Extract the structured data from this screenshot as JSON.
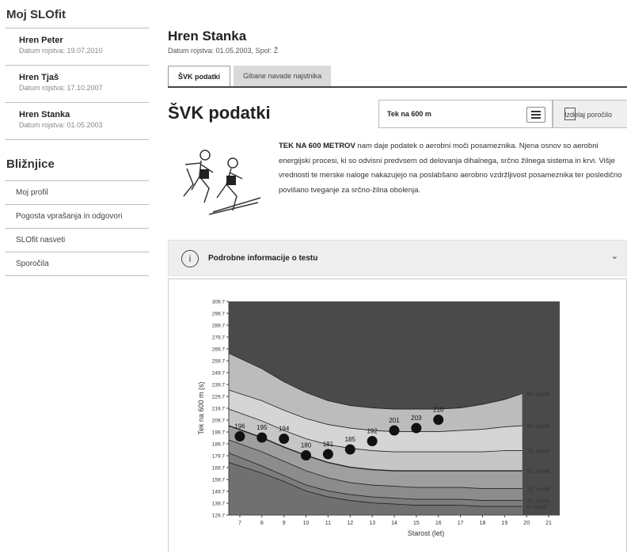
{
  "sidebar": {
    "title": "Moj SLOfit",
    "athletes": [
      {
        "name": "Hren Peter",
        "dob": "Datum rojstva: 19.07.2010"
      },
      {
        "name": "Hren Tjaš",
        "dob": "Datum rojstva: 17.10.2007"
      },
      {
        "name": "Hren Stanka",
        "dob": "Datum rojstva: 01.05.2003"
      }
    ],
    "shortcuts_title": "Bližnjice",
    "shortcuts": [
      "Moj profil",
      "Pogosta vprašanja in odgovori",
      "SLOfit nasveti",
      "Sporočila"
    ]
  },
  "main": {
    "athlete_name": "Hren Stanka",
    "athlete_meta": "Datum rojstva: 01.05.2003, Spol: Ž",
    "tabs": [
      {
        "label": "ŠVK podatki",
        "active": true
      },
      {
        "label": "Gibane navade najstnika",
        "active": false
      }
    ],
    "section_title": "ŠVK podatki",
    "test_select": "Tek na 600 m",
    "report_button": "Izdelaj poročilo",
    "description_bold": "TEK NA 600 METROV",
    "description_rest": " nam daje podatek o aerobni moči posameznika. Njena osnov so aerobni energijski procesi, ki so odvisni predvsem od delovanja dihalnega, srčno žilnega sistema in krvi. Višje vrednosti te merske naloge nakazujejo na poslabšano aerobno vzdržljivost posameznika ter posledično povišano tveganje za srčno-žilna obolenja.",
    "info_icon": "i",
    "info_title": "Podrobne informacije o testu",
    "info_chevron": "⌄"
  },
  "chart_data": {
    "type": "area",
    "xlabel": "Starost (let)",
    "ylabel": "Tek na 600 m (s)",
    "xlim": [
      6.5,
      21.5
    ],
    "ylim": [
      129.7,
      309.7
    ],
    "x_ticks": [
      "7",
      "8",
      "9",
      "10",
      "11",
      "12",
      "13",
      "14",
      "15",
      "16",
      "17",
      "18",
      "19",
      "20",
      "21"
    ],
    "y_ticks": [
      "129.7",
      "139.7",
      "149.7",
      "159.7",
      "169.7",
      "179.7",
      "189.7",
      "199.7",
      "209.7",
      "219.7",
      "229.7",
      "239.7",
      "249.7",
      "259.7",
      "269.7",
      "279.7",
      "289.7",
      "299.7",
      "309.7"
    ],
    "percentiles": [
      {
        "name": "5. centil",
        "x": [
          6.5,
          8,
          9,
          10,
          11,
          12,
          13,
          14,
          15,
          16,
          17,
          18,
          19,
          19.8
        ],
        "y": [
          174,
          165,
          158,
          150,
          145,
          142,
          140,
          139,
          138,
          138,
          138,
          137,
          137,
          137
        ]
      },
      {
        "name": "10. centil",
        "x": [
          6.5,
          8,
          9,
          10,
          11,
          12,
          13,
          14,
          15,
          16,
          17,
          18,
          19,
          19.8
        ],
        "y": [
          182,
          171,
          163,
          155,
          150,
          147,
          145,
          144,
          143,
          143,
          143,
          142,
          142,
          142
        ]
      },
      {
        "name": "25. centil",
        "x": [
          6.5,
          8,
          9,
          10,
          11,
          12,
          13,
          14,
          15,
          16,
          17,
          18,
          19,
          19.8
        ],
        "y": [
          193,
          183,
          175,
          167,
          161,
          157,
          155,
          154,
          153,
          153,
          153,
          152,
          152,
          152
        ]
      },
      {
        "name": "50. centil",
        "x": [
          6.5,
          8,
          9,
          10,
          11,
          12,
          13,
          14,
          15,
          16,
          17,
          18,
          19,
          19.8
        ],
        "y": [
          205,
          195,
          187,
          180,
          174,
          170,
          168,
          167,
          167,
          167,
          167,
          167,
          167,
          167
        ]
      },
      {
        "name": "75. centil",
        "x": [
          6.5,
          8,
          9,
          10,
          11,
          12,
          13,
          14,
          15,
          16,
          17,
          18,
          19,
          19.8
        ],
        "y": [
          219,
          209,
          201,
          194,
          189,
          186,
          184,
          183,
          183,
          183,
          183,
          183,
          184,
          184
        ]
      },
      {
        "name": "90. centil",
        "x": [
          6.5,
          8,
          9,
          10,
          11,
          12,
          13,
          14,
          15,
          16,
          17,
          18,
          19,
          19.8
        ],
        "y": [
          235,
          226,
          218,
          211,
          206,
          203,
          201,
          200,
          200,
          200,
          201,
          202,
          204,
          205
        ]
      },
      {
        "name": "95. centil",
        "x": [
          6.5,
          8,
          9,
          10,
          11,
          12,
          13,
          14,
          15,
          16,
          17,
          18,
          19,
          19.8
        ],
        "y": [
          266,
          253,
          242,
          233,
          226,
          222,
          220,
          219,
          219,
          219,
          220,
          223,
          227,
          232
        ]
      }
    ],
    "points": [
      {
        "x": 7,
        "y": 196
      },
      {
        "x": 8,
        "y": 195
      },
      {
        "x": 9,
        "y": 194
      },
      {
        "x": 10,
        "y": 180
      },
      {
        "x": 11,
        "y": 181
      },
      {
        "x": 12,
        "y": 185
      },
      {
        "x": 13,
        "y": 192
      },
      {
        "x": 14,
        "y": 201
      },
      {
        "x": 15,
        "y": 203
      },
      {
        "x": 16,
        "y": 210
      }
    ],
    "colors": {
      "bg": "#4a4a4a",
      "band95": "#bcbcbc",
      "band90": "#d5d5d5",
      "band75": "#c6c6c6",
      "band50": "#9f9f9f",
      "band25": "#8c8c8c",
      "band10": "#7d7d7d",
      "band5": "#707070",
      "point": "#111111",
      "line": "#222222"
    }
  }
}
